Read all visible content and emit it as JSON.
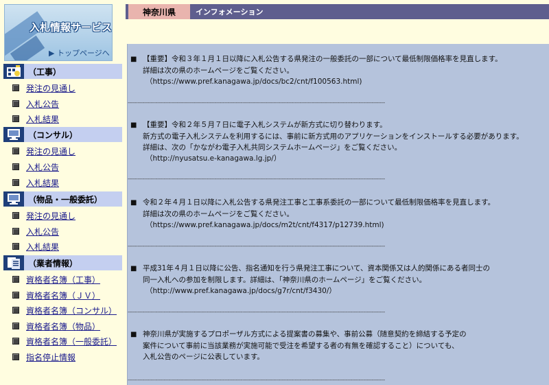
{
  "logo": {
    "title": "入札情報サービス",
    "top_link": "▶ トップページへ"
  },
  "sidebar": {
    "categories": [
      {
        "label": "（工事）",
        "icon": "construction-icon",
        "items": [
          "発注の見通し",
          "入札公告",
          "入札結果"
        ]
      },
      {
        "label": "（コンサル）",
        "icon": "monitor-icon",
        "items": [
          "発注の見通し",
          "入札公告",
          "入札結果"
        ]
      },
      {
        "label": "（物品・一般委託）",
        "icon": "monitor-icon",
        "items": [
          "発注の見通し",
          "入札公告",
          "入札結果"
        ]
      },
      {
        "label": "（業者情報）",
        "icon": "documents-icon",
        "items": [
          "資格者名簿（工事）",
          "資格者名簿（ＪＶ）",
          "資格者名簿（コンサル）",
          "資格者名簿（物品）",
          "資格者名簿（一般委託）",
          "指名停止情報"
        ]
      }
    ]
  },
  "header": {
    "prefecture": "神奈川県",
    "title": "インフォメーション"
  },
  "notices": [
    {
      "mark": "■",
      "lines": [
        "【重要】令和３年１月１日以降に入札公告する県発注の一般委託の一部について最低制限価格率を見直します。",
        "詳細は次の県のホームページをご覧ください。",
        "（https://www.pref.kanagawa.jp/docs/bc2/cnt/f100563.html)"
      ]
    },
    {
      "mark": "■",
      "lines": [
        "【重要】令和２年５月７日に電子入札システムが新方式に切り替わります。",
        "新方式の電子入札システムを利用するには、事前に新方式用のアプリケーションをインストールする必要があります。",
        "詳細は、次の「かながわ電子入札共同システムホームページ」をご覧ください。",
        "（http://nyusatsu.e-kanagawa.lg.jp/）"
      ]
    },
    {
      "mark": "■",
      "lines": [
        "令和２年４月１日以降に入札公告する県発注工事と工事系委託の一部について最低制限価格率を見直します。",
        "詳細は次の県のホームページをご覧ください。",
        "（https://www.pref.kanagawa.jp/docs/m2t/cnt/f4317/p12739.html)"
      ]
    },
    {
      "mark": "■",
      "lines": [
        "平成31年４月１日以降に公告、指名通知を行う県発注工事について、資本関係又は人的関係にある者同士の",
        "同一入札への参加を制限します。詳細は、「神奈川県のホームページ」をご覧ください。",
        "（http://www.pref.kanagawa.jp/docs/g7r/cnt/f3430/）"
      ]
    },
    {
      "mark": "■",
      "lines": [
        "神奈川県が実施するプロポーザル方式による提案書の募集や、事前公募（随意契約を締結する予定の",
        "案件について事前に当該業務が実施可能で受注を希望する者の有無を確認すること）についても、",
        "入札公告のページに公表しています。"
      ]
    }
  ],
  "separator": "------------------------------------------------------------------------------------------------------------------------------------------------------------------------------------------------------"
}
